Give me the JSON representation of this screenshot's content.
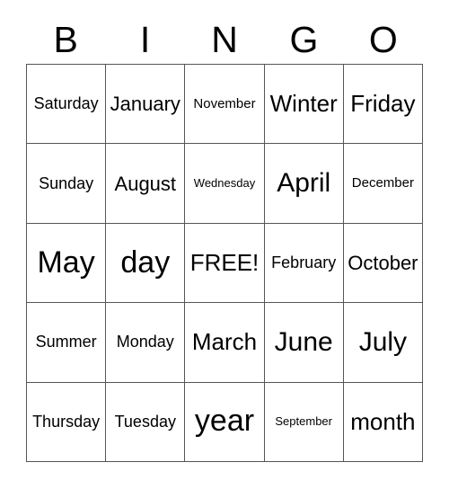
{
  "card": {
    "header_letters": [
      "B",
      "I",
      "N",
      "G",
      "O"
    ],
    "free_space_label": "FREE!",
    "text_color": "#000000",
    "border_color": "#555555",
    "background_color": "#ffffff",
    "rows": [
      [
        {
          "label": "Saturday",
          "size": "fs-s"
        },
        {
          "label": "January",
          "size": "fs-m"
        },
        {
          "label": "November",
          "size": "fs-xs"
        },
        {
          "label": "Winter",
          "size": "fs-l"
        },
        {
          "label": "Friday",
          "size": "fs-l"
        }
      ],
      [
        {
          "label": "Sunday",
          "size": "fs-s"
        },
        {
          "label": "August",
          "size": "fs-m"
        },
        {
          "label": "Wednesday",
          "size": "fs-xxs"
        },
        {
          "label": "April",
          "size": "fs-xl"
        },
        {
          "label": "December",
          "size": "fs-xs"
        }
      ],
      [
        {
          "label": "May",
          "size": "fs-xxl"
        },
        {
          "label": "day",
          "size": "fs-xxl"
        },
        {
          "label": "FREE!",
          "size": "fs-l"
        },
        {
          "label": "February",
          "size": "fs-s"
        },
        {
          "label": "October",
          "size": "fs-m"
        }
      ],
      [
        {
          "label": "Summer",
          "size": "fs-s"
        },
        {
          "label": "Monday",
          "size": "fs-s"
        },
        {
          "label": "March",
          "size": "fs-l"
        },
        {
          "label": "June",
          "size": "fs-xl"
        },
        {
          "label": "July",
          "size": "fs-xl"
        }
      ],
      [
        {
          "label": "Thursday",
          "size": "fs-s"
        },
        {
          "label": "Tuesday",
          "size": "fs-s"
        },
        {
          "label": "year",
          "size": "fs-xxl"
        },
        {
          "label": "September",
          "size": "fs-xxs"
        },
        {
          "label": "month",
          "size": "fs-l"
        }
      ]
    ]
  }
}
